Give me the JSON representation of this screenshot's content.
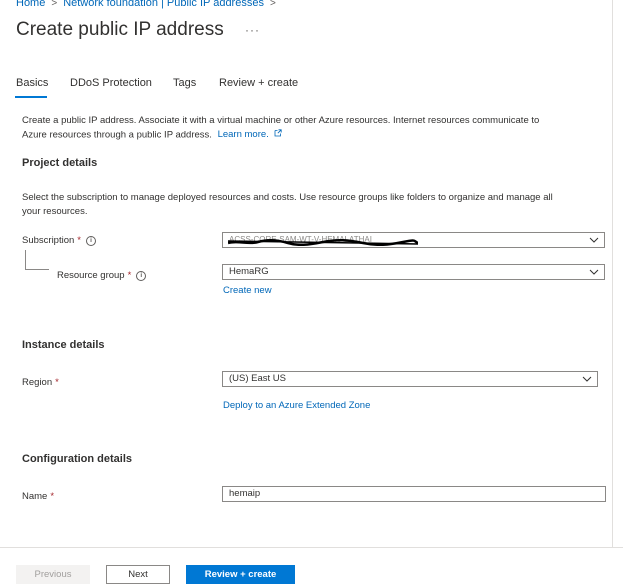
{
  "breadcrumb": {
    "items": [
      "Home",
      "Network foundation | Public IP addresses"
    ]
  },
  "page": {
    "title": "Create public IP address",
    "more_label": "···"
  },
  "tabs": [
    {
      "label": "Basics",
      "active": true
    },
    {
      "label": "DDoS Protection",
      "active": false
    },
    {
      "label": "Tags",
      "active": false
    },
    {
      "label": "Review + create",
      "active": false
    }
  ],
  "intro": {
    "line1": "Create a public IP address. Associate it with a virtual machine or other Azure resources. Internet resources communicate to",
    "line2": "Azure resources through a public IP address.",
    "learn_more": "Learn more."
  },
  "project": {
    "heading": "Project details",
    "desc_line1": "Select the subscription to manage deployed resources and costs. Use resource groups like folders to organize and manage all",
    "desc_line2": "your resources.",
    "subscription_label": "Subscription",
    "subscription_value": "ACSS-CORE-SAM-WT-V-HEMALATHAI",
    "resource_group_label": "Resource group",
    "resource_group_value": "HemaRG",
    "create_new": "Create new"
  },
  "instance": {
    "heading": "Instance details",
    "region_label": "Region",
    "region_value": "(US) East US",
    "extended_zone_link": "Deploy to an Azure Extended Zone"
  },
  "config": {
    "heading": "Configuration details",
    "name_label": "Name",
    "name_value": "hemaip"
  },
  "footer": {
    "previous": "Previous",
    "next": "Next",
    "review_create": "Review + create"
  },
  "colors": {
    "accent": "#0078d4",
    "link": "#0067b8",
    "required": "#a4262c"
  }
}
